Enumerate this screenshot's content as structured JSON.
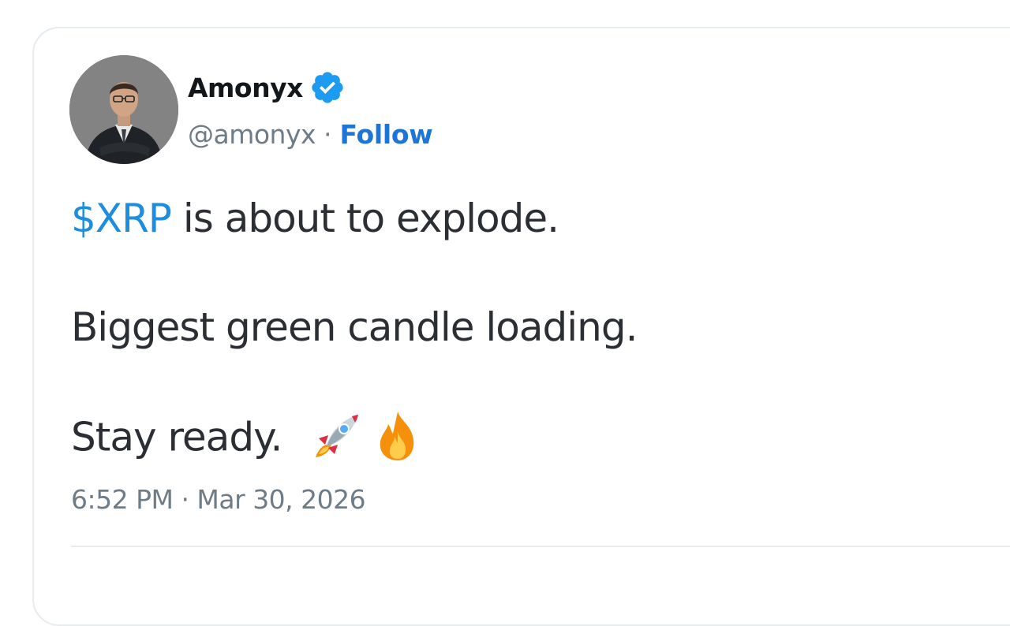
{
  "tweet": {
    "author": {
      "name": "Amonyx",
      "handle": "@amonyx",
      "separator": "·",
      "follow_label": "Follow",
      "avatar_icon": "profile-photo"
    },
    "body": {
      "cashtag": "$XRP",
      "line1_rest": " is about to explode.",
      "line2": "Biggest green candle loading.",
      "line3": "Stay ready.",
      "emojis": [
        "rocket-emoji",
        "fire-emoji"
      ]
    },
    "timestamp": "6:52 PM · Mar 30, 2026"
  },
  "colors": {
    "link_blue": "#1d75d8",
    "cashtag_blue": "#1d8ddf",
    "verified_blue": "#1d9bf0",
    "text": "#2b2f33",
    "muted": "#6e7c87"
  }
}
